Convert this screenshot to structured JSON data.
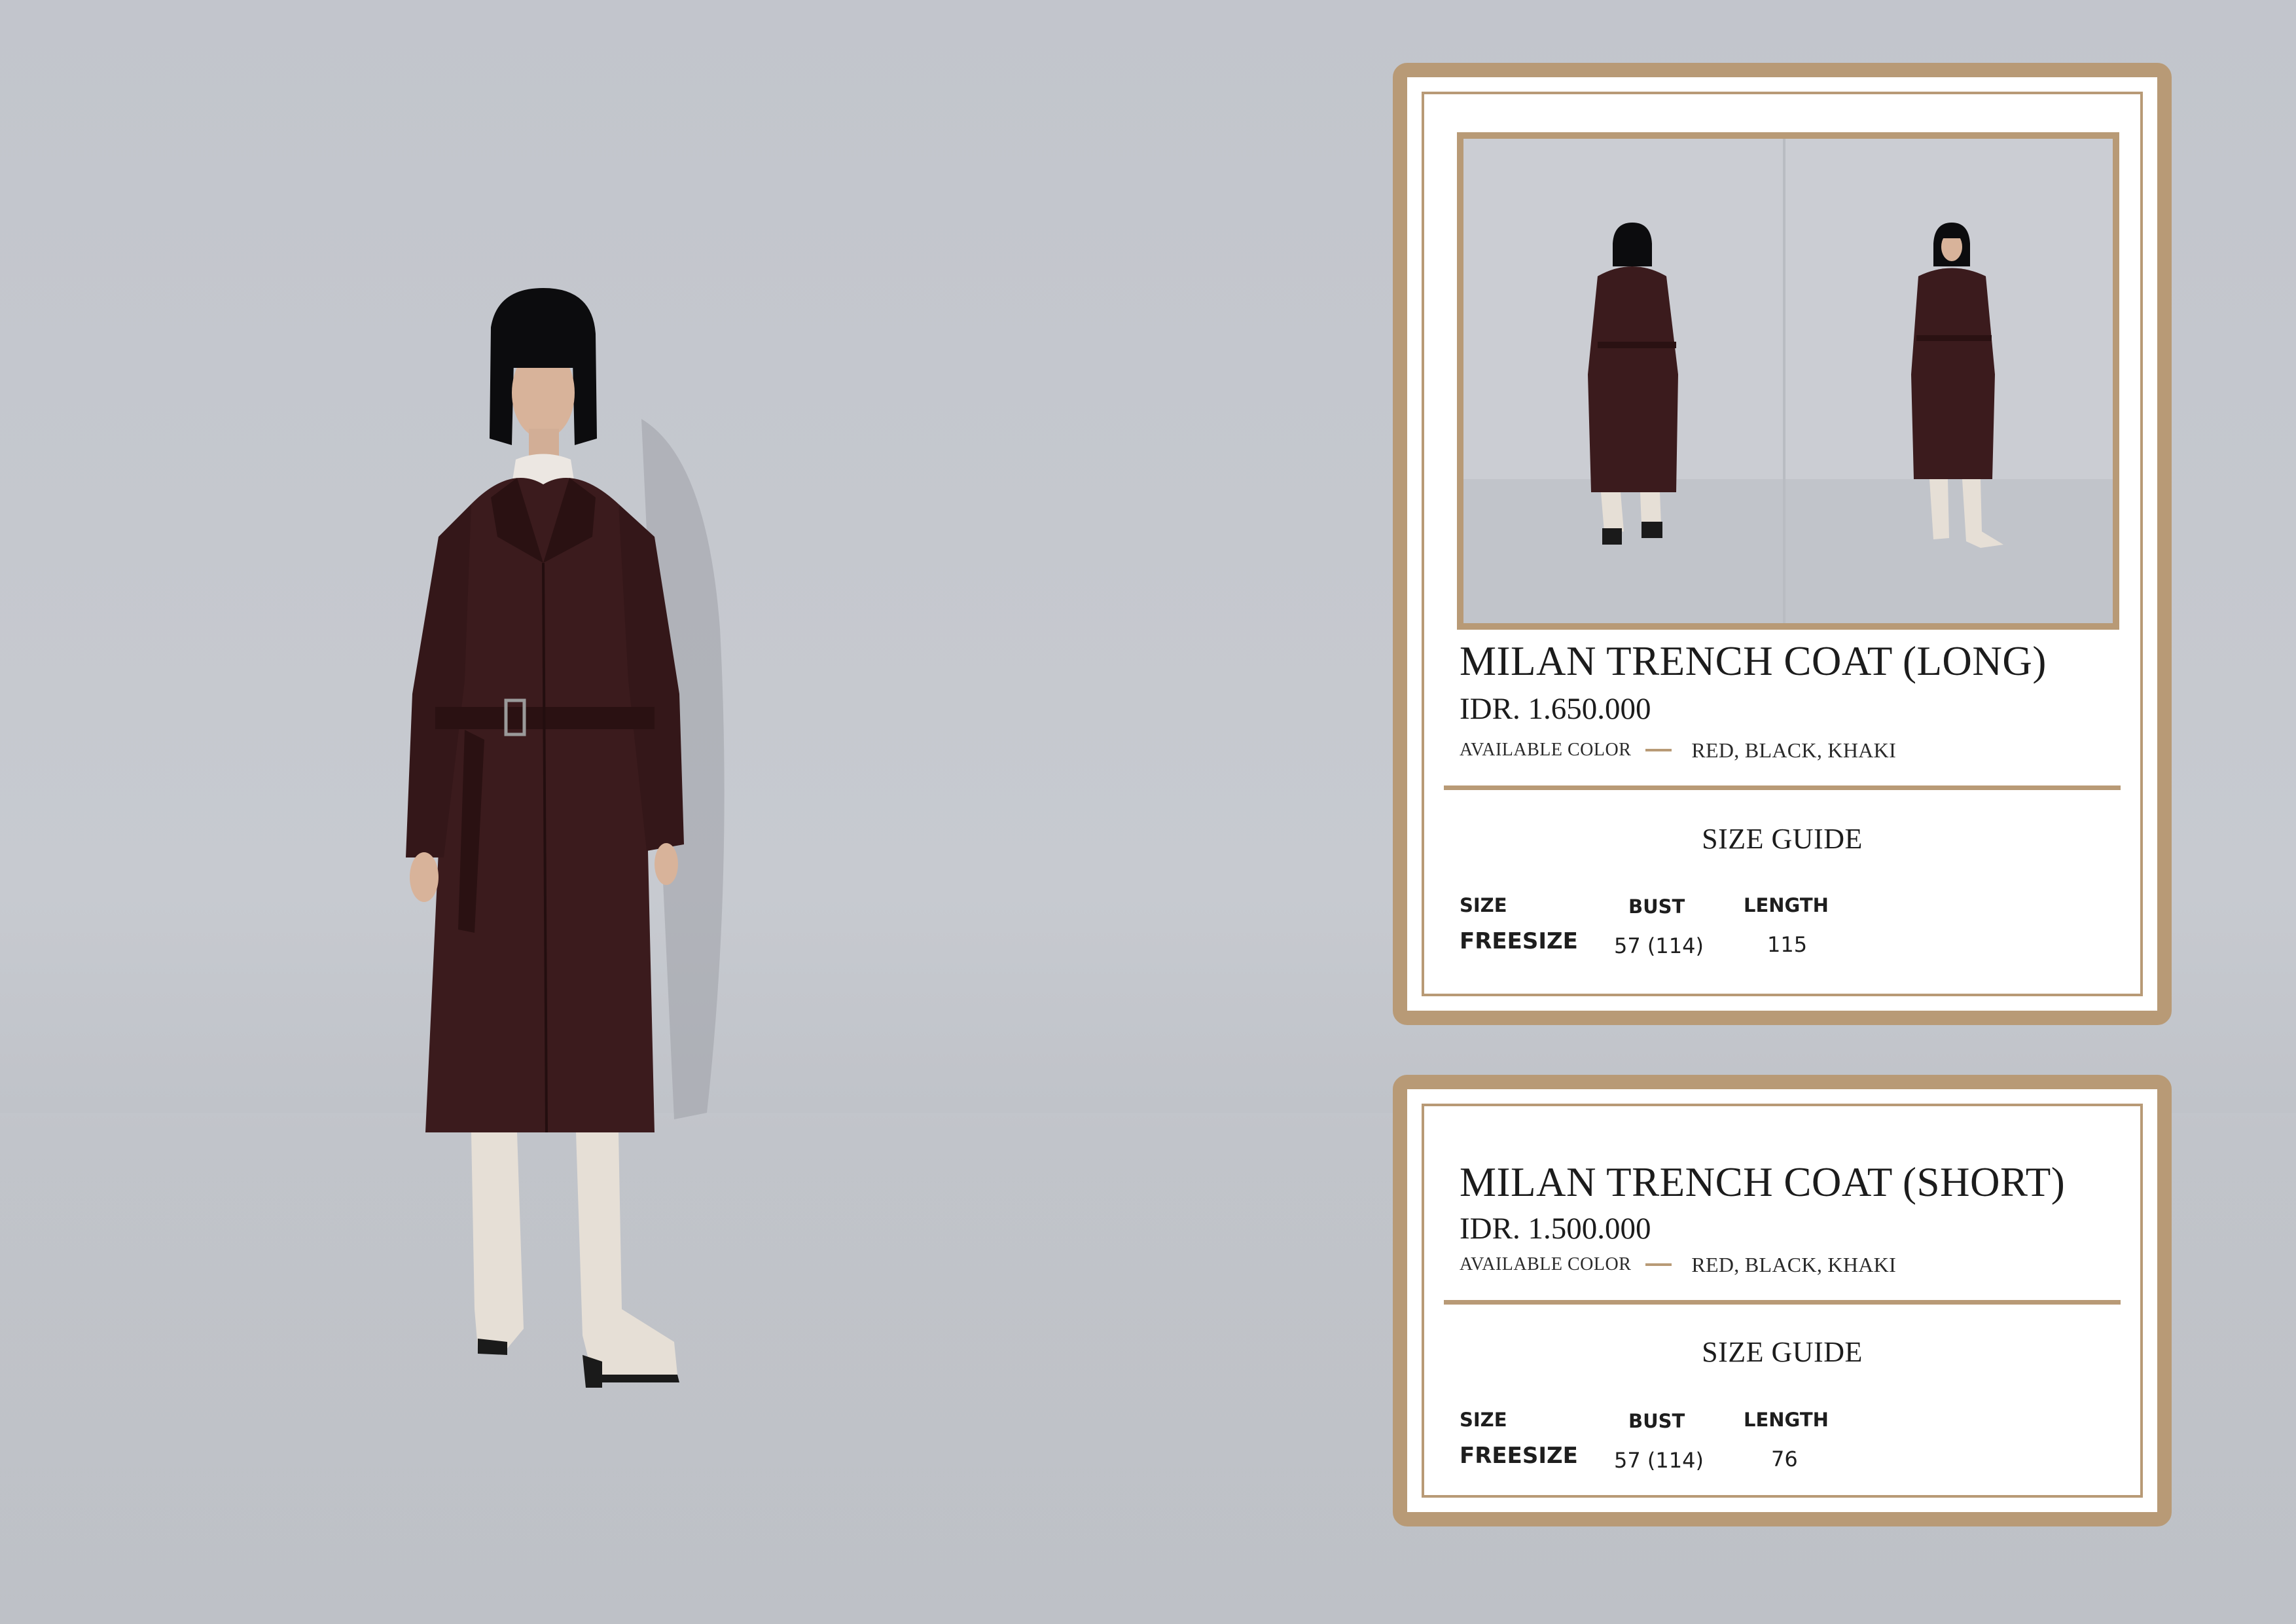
{
  "colors": {
    "accent_tan": "#b89a76",
    "backdrop_grey": "#c4c7cd",
    "coat_burgundy": "#3b1b1d",
    "text": "#1c1c1c"
  },
  "products": [
    {
      "name": "MILAN TRENCH COAT (LONG)",
      "price": "IDR. 1.650.000",
      "available_color_label": "AVAILABLE COLOR",
      "available_colors": "RED, BLACK, KHAKI",
      "size_guide": {
        "title": "SIZE GUIDE",
        "headers": [
          "SIZE",
          "BUST",
          "LENGTH"
        ],
        "rows": [
          [
            "FREESIZE",
            "57 (114)",
            "115"
          ]
        ]
      }
    },
    {
      "name": "MILAN TRENCH COAT (SHORT)",
      "price": "IDR. 1.500.000",
      "available_color_label": "AVAILABLE COLOR",
      "available_colors": "RED, BLACK, KHAKI",
      "size_guide": {
        "title": "SIZE GUIDE",
        "headers": [
          "SIZE",
          "BUST",
          "LENGTH"
        ],
        "rows": [
          [
            "FREESIZE",
            "57 (114)",
            "76"
          ]
        ]
      }
    }
  ]
}
